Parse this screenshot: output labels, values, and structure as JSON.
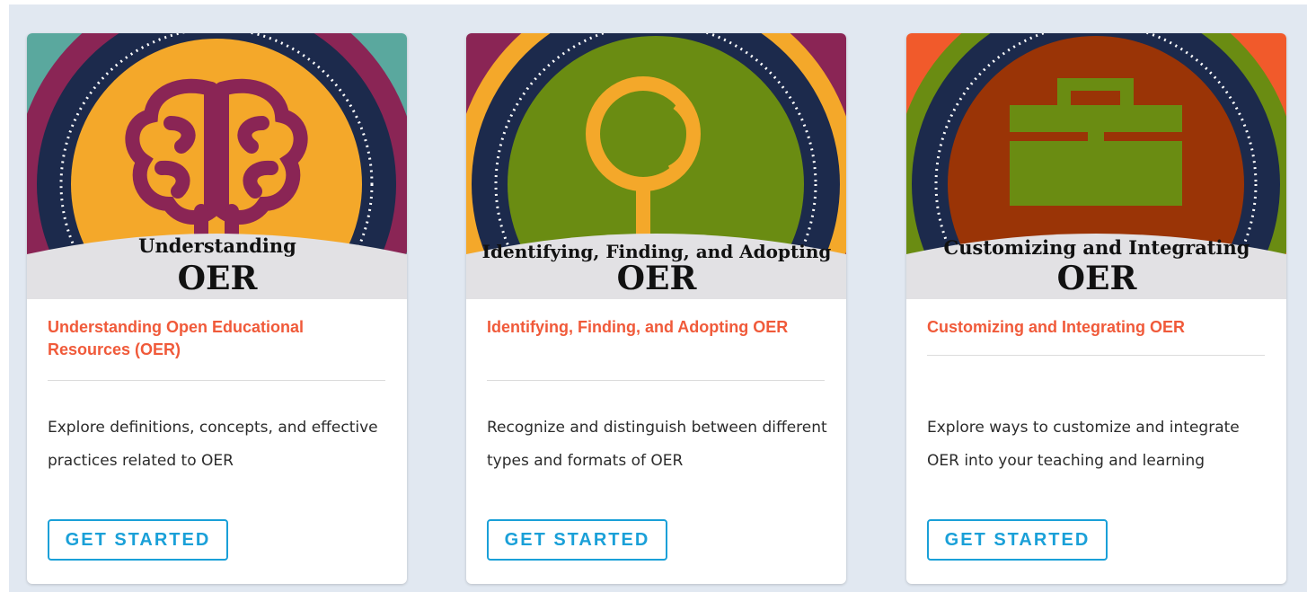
{
  "cards": [
    {
      "banner_line1": "Understanding",
      "banner_line2": "OER",
      "title": "Understanding Open Educational Resources (OER)",
      "description": "Explore definitions, concepts, and effective practices related to OER",
      "button_label": "GET STARTED",
      "icon": "brain-icon",
      "colors": {
        "corner": "#5aa89e",
        "outer_ring": "#8a2555",
        "middle_ring": "#1c2a4c",
        "inner_circle": "#f4a82a",
        "icon": "#8a2555"
      }
    },
    {
      "banner_line1": "Identifying, Finding, and Adopting",
      "banner_line2": "OER",
      "title": "Identifying, Finding, and Adopting OER",
      "description": "Recognize and distinguish between different types and formats of OER",
      "button_label": "GET STARTED",
      "icon": "magnifying-glass-icon",
      "colors": {
        "corner": "#8a2555",
        "outer_ring": "#f4a82a",
        "middle_ring": "#1c2a4c",
        "inner_circle": "#6a8c12",
        "icon": "#f4a82a"
      }
    },
    {
      "banner_line1": "Customizing and Integrating",
      "banner_line2": "OER",
      "title": "Customizing and Integrating OER",
      "description": "Explore ways to customize and integrate OER into your teaching and learning",
      "button_label": "GET STARTED",
      "icon": "toolbox-icon",
      "colors": {
        "corner": "#f15a2b",
        "outer_ring": "#6a8c12",
        "middle_ring": "#1c2a4c",
        "inner_circle": "#9a3406",
        "icon": "#6a8c12"
      }
    }
  ],
  "theme": {
    "title_color": "#f05a3a",
    "button_color": "#1aa0d8",
    "panel_background": "#e1e8f1",
    "banner_band": "#e2e1e4"
  }
}
